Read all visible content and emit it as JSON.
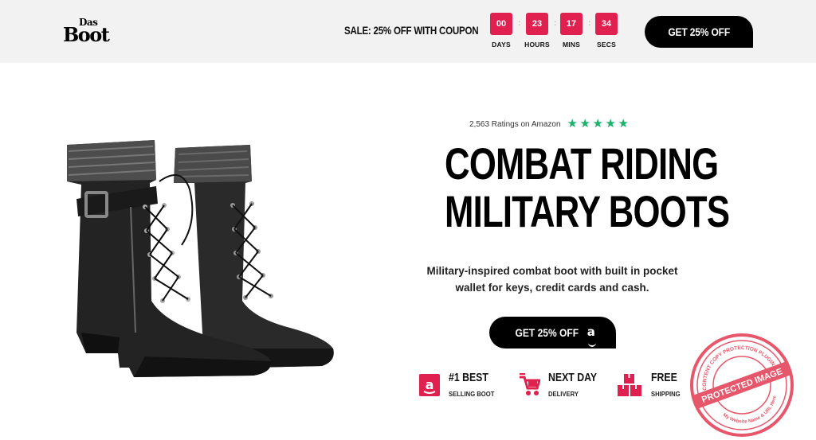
{
  "brand": {
    "logo_top": "Das",
    "logo_bottom": "Boot"
  },
  "promo_bar": {
    "sale_text": "SALE: 25% OFF WITH COUPON",
    "countdown": [
      {
        "value": "00",
        "label": "DAYS"
      },
      {
        "value": "23",
        "label": "HOURS"
      },
      {
        "value": "17",
        "label": "MINS"
      },
      {
        "value": "34",
        "label": "SECS"
      }
    ],
    "separator": ":",
    "cta_label": "GET 25% OFF"
  },
  "hero": {
    "product_image_alt": "Combat riding military boots pair",
    "ratings_text": "2,563 Ratings on Amazon",
    "star_rating": 5,
    "star_color": "#1ab26b",
    "headline_line1": "COMBAT RIDING",
    "headline_line2": "MILITARY BOOTS",
    "description": "Military-inspired combat boot with built in pocket wallet for keys, credit cards and cash.",
    "cta_label": "GET 25% OFF",
    "cta_icon": "amazon-a-icon"
  },
  "features": [
    {
      "icon": "amazon-badge-icon",
      "title": "#1 BEST",
      "subtitle": "SELLING BOOT"
    },
    {
      "icon": "cart-fast-icon",
      "title": "NEXT DAY",
      "subtitle": "DELIVERY"
    },
    {
      "icon": "boxes-icon",
      "title": "FREE",
      "subtitle": "SHIPPING"
    }
  ],
  "watermark": {
    "center_text": "PROTECTED IMAGE",
    "outer_text_top": "CONTENT COPY PROTECTION PLUGIN",
    "outer_text_bottom": "My Website Name & URL Here"
  },
  "colors": {
    "accent": "#e0204f",
    "bar_bg": "#f2f2f2",
    "cta_bg": "#000000",
    "stamp": "#e0203a"
  }
}
